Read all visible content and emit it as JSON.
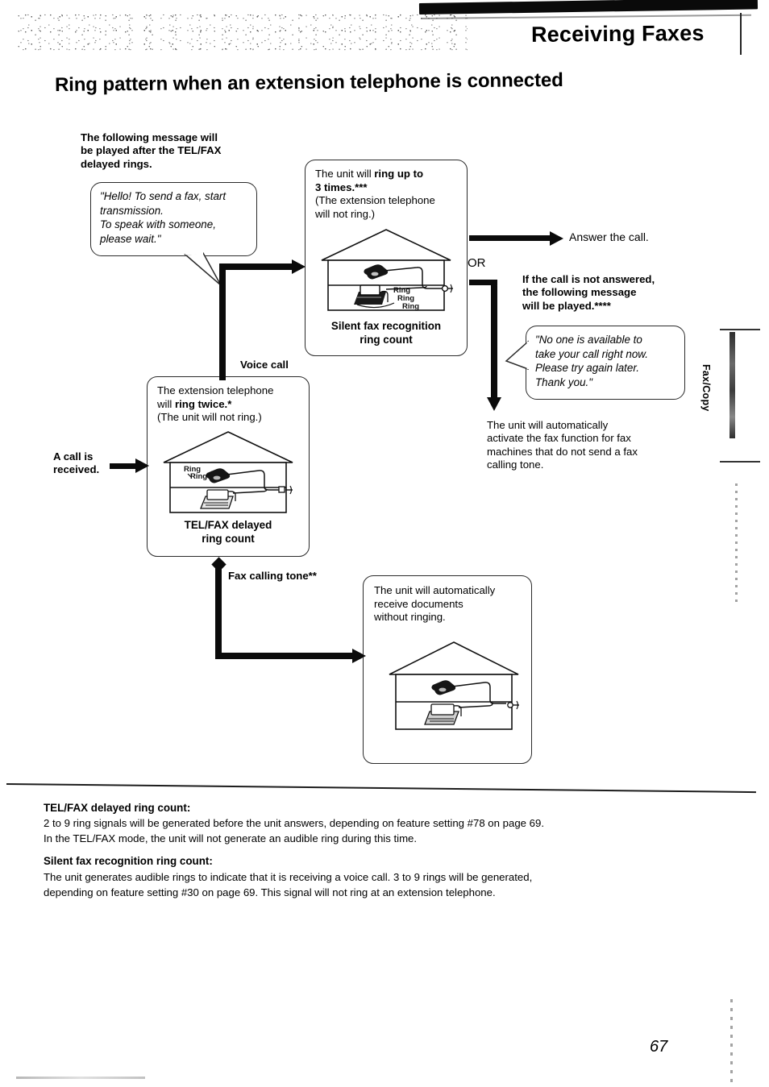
{
  "header": {
    "section_title": "Receiving Faxes",
    "page_heading": "Ring pattern when an extension telephone is connected"
  },
  "side_tab": {
    "label": "Fax/Copy"
  },
  "flow": {
    "intro_note": "The following message will\nbe played after the TEL/FAX\ndelayed rings.",
    "bubble_greeting": "\"Hello! To send a fax, start\ntransmission.\nTo speak with someone,\nplease wait.\"",
    "entry_label": "A call is\nreceived.",
    "voice_call_label": "Voice call",
    "fax_tone_label": "Fax calling tone**",
    "or_label": "OR",
    "answer_call_label": "Answer the call.",
    "not_answered_note": "If the call is not answered,\nthe following message\nwill be played.****",
    "bubble_unavailable": "\"No one is available to\ntake your call right now.\nPlease try again later.\nThank you.\"",
    "auto_fax_note": "The unit will automatically\nactivate the fax function for fax\nmachines that do not send a fax\ncalling tone."
  },
  "boxes": {
    "silent_recognition": {
      "text_a": "The unit will ",
      "text_b": "ring up to",
      "text_c": "3 times.***",
      "text_d": "(The extension telephone\nwill not ring.)",
      "caption": "Silent fax recognition\nring count",
      "house_ring_label": "Ring\nRing\nRing"
    },
    "extension_ring": {
      "text_a": "The extension telephone",
      "text_b": "will ",
      "text_c": "ring twice.*",
      "text_d": "(The unit will not ring.)",
      "caption": "TEL/FAX delayed\nring count",
      "house_ring_label": "Ring\nRing"
    },
    "auto_receive": {
      "text": "The unit will automatically\nreceive documents\nwithout ringing."
    }
  },
  "footnotes": [
    {
      "heading": "TEL/FAX delayed ring count:",
      "body": "2 to 9 ring signals will be generated before the unit answers, depending on feature setting #78 on page 69.\nIn the TEL/FAX mode, the unit will not generate an audible ring during this time."
    },
    {
      "heading": "Silent fax recognition ring count:",
      "body": "The unit generates audible rings to indicate that it is receiving a voice call. 3 to 9 rings will be generated,\ndepending on feature setting #30 on page 69. This signal will not ring at an extension telephone."
    }
  ],
  "page_number": "67",
  "colors": {
    "ink": "#0b0b0b",
    "paper": "#ffffff",
    "line": "#2a2a2a"
  }
}
